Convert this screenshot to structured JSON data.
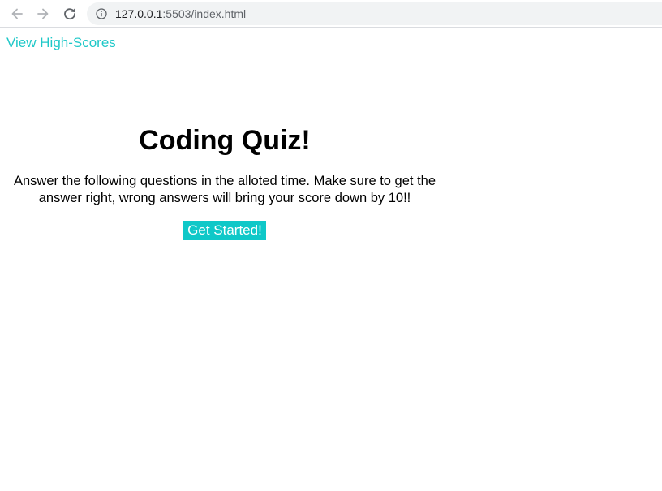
{
  "browser": {
    "url_host": "127.0.0.1",
    "url_rest": ":5503/index.html",
    "back_icon": "arrow-left-icon",
    "forward_icon": "arrow-right-icon",
    "reload_icon": "reload-icon",
    "info_icon": "info-icon"
  },
  "header": {
    "high_scores_label": "View High-Scores"
  },
  "quiz": {
    "title": "Coding Quiz!",
    "description": "Answer the following questions in the alloted time. Make sure to get the answer right, wrong answers will bring your score down by 10!!",
    "start_label": "Get Started!"
  },
  "colors": {
    "accent": "#0fc8c8",
    "link": "#1fc8c8"
  }
}
